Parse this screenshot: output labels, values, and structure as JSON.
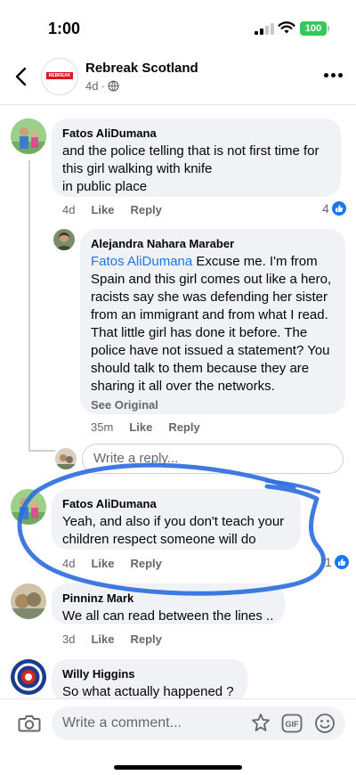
{
  "status_bar": {
    "time": "1:00",
    "battery": "100"
  },
  "header": {
    "page_name": "Rebreak Scotland",
    "age": "4d",
    "separator": "·",
    "logo_text": "REBREAK NEWS"
  },
  "comments": [
    {
      "author": "Fatos AliDumana",
      "text": "and the police telling that is not first time for this girl walking with knife\nin public place",
      "time": "4d",
      "like": "Like",
      "reply": "Reply",
      "reaction_count": "4"
    },
    {
      "author": "Alejandra Nahara Maraber",
      "mention": "Fatos AliDumana",
      "text": " Excuse me. I'm from Spain and this girl comes out like a hero, racists say she was defending her sister from an immigrant and from what I read. That little girl has done it before. The police have not issued a statement? You should talk to them because they are sharing it all over the networks.",
      "see_original": "See Original",
      "time": "35m",
      "like": "Like",
      "reply": "Reply"
    },
    {
      "author": "Fatos AliDumana",
      "text": "Yeah, and also if you don't teach your children respect someone will do",
      "time": "4d",
      "like": "Like",
      "reply": "Reply",
      "reaction_count": "1"
    },
    {
      "author": "Pinninz Mark",
      "text": "We all can read between the lines ..",
      "time": "3d",
      "like": "Like",
      "reply": "Reply"
    },
    {
      "author": "Willy Higgins",
      "text": "So what actually happened ?"
    }
  ],
  "reply_input": {
    "placeholder": "Write a reply..."
  },
  "comment_input": {
    "placeholder": "Write a comment..."
  },
  "colors": {
    "accent": "#1877f2",
    "scribble": "#2f6fe0",
    "bubble": "#f0f2f5",
    "battery": "#34c759"
  },
  "icons": [
    "back-icon",
    "globe-icon",
    "more-icon",
    "like-icon",
    "camera-icon",
    "avatar-sticker-icon",
    "gif-icon",
    "emoji-icon"
  ]
}
